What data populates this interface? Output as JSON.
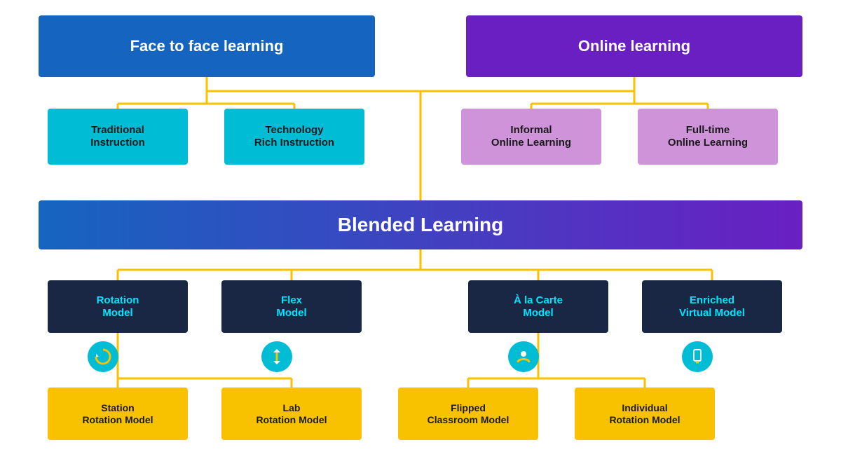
{
  "nodes": {
    "face_to_face": "Face to face learning",
    "online_learning": "Online learning",
    "traditional": "Traditional\nInstruction",
    "tech_rich": "Technology\nRich Instruction",
    "informal_online": "Informal\nOnline Learning",
    "fulltime_online": "Full-time\nOnline Learning",
    "blended": "Blended Learning",
    "rotation": "Rotation\nModel",
    "flex": "Flex\nModel",
    "alacarte": "À la Carte\nModel",
    "enriched": "Enriched\nVirtual Model",
    "station_rotation": "Station\nRotation Model",
    "lab_rotation": "Lab\nRotation Model",
    "flipped": "Flipped\nClassroom Model",
    "individual_rotation": "Individual\nRotation Model"
  },
  "icons": {
    "rotation": "↻",
    "flex": "⇅",
    "alacarte": "👤",
    "enriched": "📱"
  }
}
